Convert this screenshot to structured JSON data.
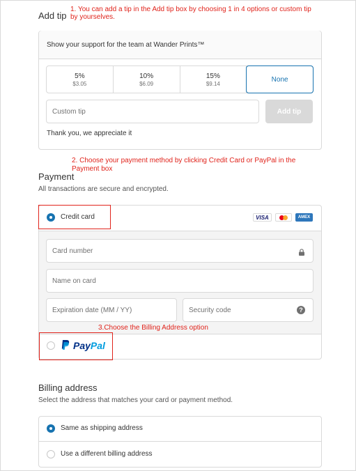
{
  "annotations": {
    "tip_line1": "1. You can add a tip in the Add tip box by choosing 1 in 4 options or custom tip",
    "tip_line2": "by yourselves.",
    "payment_line1": "2. Choose your payment method by clicking Credit Card or PayPal in the",
    "payment_line2": "Payment box",
    "billing": "3.Choose the Billing Address option"
  },
  "tip": {
    "heading": "Add tip",
    "support_text": "Show your support for the team at Wander Prints™",
    "options": [
      {
        "percent": "5%",
        "amount": "$3.05"
      },
      {
        "percent": "10%",
        "amount": "$6.09"
      },
      {
        "percent": "15%",
        "amount": "$9.14"
      }
    ],
    "none_label": "None",
    "custom_placeholder": "Custom tip",
    "add_button": "Add tip",
    "thanks": "Thank you, we appreciate it"
  },
  "payment": {
    "heading": "Payment",
    "subtitle": "All transactions are secure and encrypted.",
    "credit_card_label": "Credit card",
    "card_brands": {
      "visa": "VISA",
      "amex": "AMEX"
    },
    "card_number_placeholder": "Card number",
    "name_placeholder": "Name on card",
    "expiry_placeholder": "Expiration date (MM / YY)",
    "security_placeholder": "Security code",
    "paypal_label_p1": "Pay",
    "paypal_label_p2": "Pal"
  },
  "billing": {
    "heading": "Billing address",
    "subtitle": "Select the address that matches your card or payment method.",
    "same_label": "Same as shipping address",
    "different_label": "Use a different billing address"
  },
  "colors": {
    "accent": "#1773b0",
    "annotation": "#e0231b",
    "paypal_dark": "#003087",
    "paypal_light": "#009cde"
  }
}
